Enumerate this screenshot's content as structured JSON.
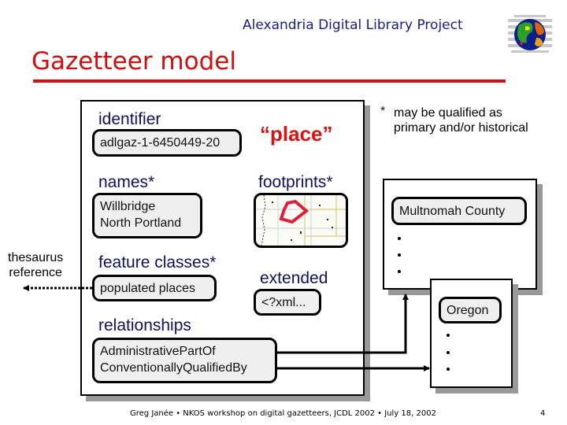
{
  "header": {
    "org_title": "Alexandria Digital Library Project",
    "logo": "globe-logo-icon"
  },
  "slide": {
    "title": "Gazetteer model"
  },
  "model": {
    "place_label": "“place”",
    "identifier": {
      "label": "identifier",
      "value": "adlgaz-1-6450449-20"
    },
    "names": {
      "label": "names*",
      "values": [
        "Willbridge",
        "North Portland"
      ]
    },
    "footprints": {
      "label": "footprints*",
      "map": "footprint-map-thumbnail"
    },
    "feature_classes": {
      "label": "feature classes*",
      "value": "populated places"
    },
    "extended": {
      "label": "extended",
      "value": "<?xml..."
    },
    "relationships": {
      "label": "relationships",
      "values": [
        "AdministrativePartOf",
        "ConventionallyQualifiedBy"
      ]
    }
  },
  "note": {
    "star": "*",
    "text": "may be qualified as primary and/or historical"
  },
  "thesaurus": {
    "line1": "thesaurus",
    "line2": "reference"
  },
  "related_places": [
    {
      "name": "Multnomah County"
    },
    {
      "name": "Oregon"
    }
  ],
  "footer": {
    "text": "Greg Janée • NKOS workshop on digital gazetteers, JCDL 2002 • July 18, 2002",
    "page_number": "4"
  },
  "colors": {
    "header_text": "#1a1a8c",
    "title_red": "#d01010",
    "label_navy": "#101060",
    "place_red": "#e01010",
    "field_fill": "#efefef",
    "shadow": "#999999"
  }
}
